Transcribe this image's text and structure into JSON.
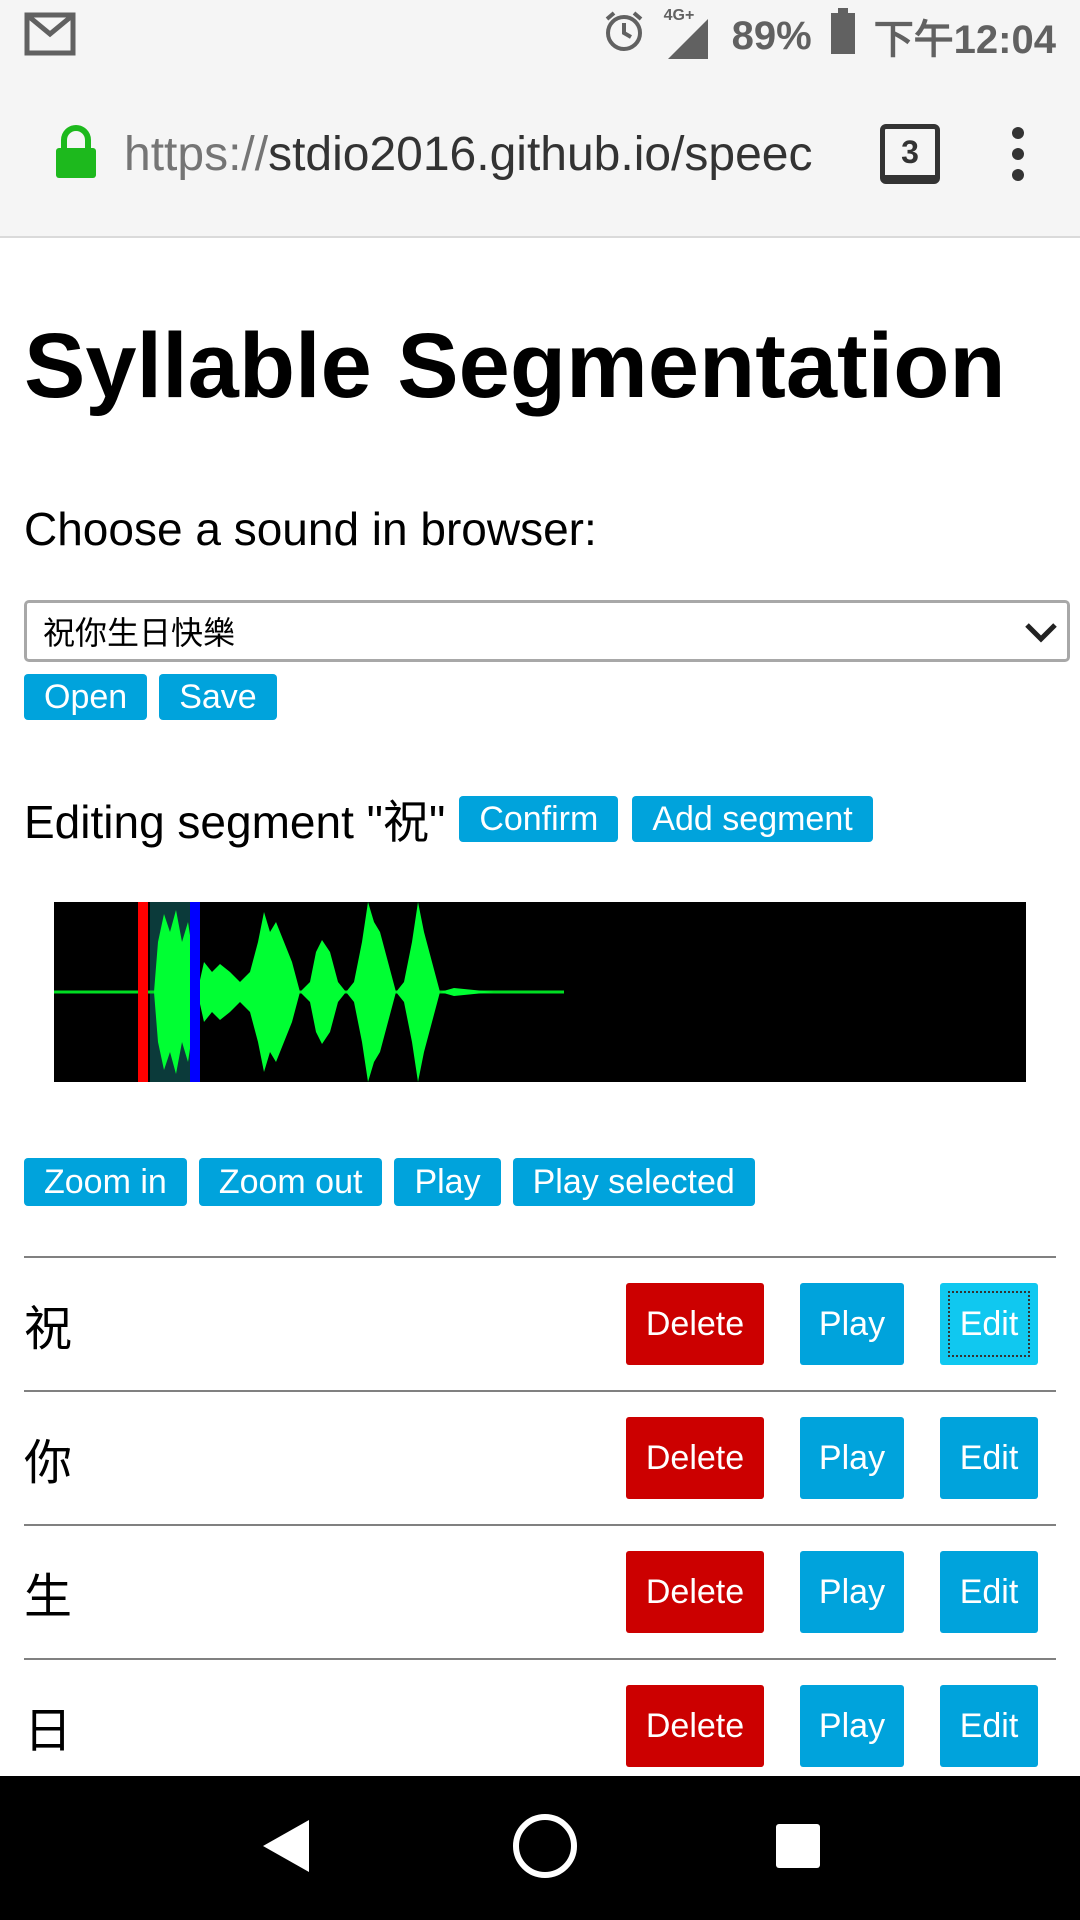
{
  "status_bar": {
    "network": "4G+",
    "battery": "89%",
    "time": "下午12:04"
  },
  "browser": {
    "url_scheme": "https://",
    "url_rest": "stdio2016.github.io/speec",
    "tab_count": "3"
  },
  "page": {
    "title": "Syllable Segmentation",
    "choose_label": "Choose a sound in browser:",
    "selected_sound": "祝你生日快樂",
    "open_label": "Open",
    "save_label": "Save",
    "editing_label": "Editing segment \"祝\"",
    "confirm_label": "Confirm",
    "add_segment_label": "Add segment",
    "tools": {
      "zoom_in": "Zoom in",
      "zoom_out": "Zoom out",
      "play": "Play",
      "play_selected": "Play selected"
    },
    "segments": [
      {
        "char": "祝",
        "delete": "Delete",
        "play": "Play",
        "edit": "Edit"
      },
      {
        "char": "你",
        "delete": "Delete",
        "play": "Play",
        "edit": "Edit"
      },
      {
        "char": "生",
        "delete": "Delete",
        "play": "Play",
        "edit": "Edit"
      },
      {
        "char": "日",
        "delete": "Delete",
        "play": "Play",
        "edit": "Edit"
      }
    ]
  },
  "colors": {
    "button_blue": "#00a3dc",
    "delete_red": "#cc0000",
    "wave_green": "#00ff33",
    "selection_start": "#ff0000",
    "selection_end": "#0000ff"
  }
}
